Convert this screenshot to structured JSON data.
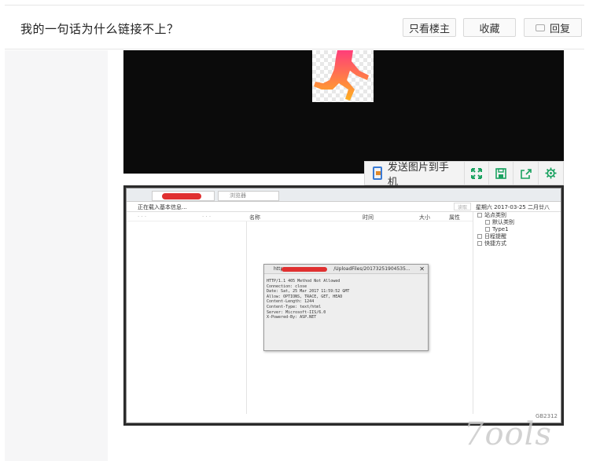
{
  "header": {
    "title": "我的一句话为什么链接不上？",
    "buttons": {
      "only_op": "只看楼主",
      "favorite": "收藏",
      "reply": "回复"
    }
  },
  "image_toolbar": {
    "send_to_phone": "发送图片到手机"
  },
  "screenshot": {
    "tab2": "浏览器",
    "loading": "正在载入基本信息...",
    "read_button": "读取",
    "date": "星期六 2017-03-25 二月廿八",
    "columns": {
      "name": "名称",
      "time": "时间",
      "size": "大小",
      "attr": "属性"
    },
    "dots1": "· · ·",
    "dots2": "· · ·",
    "tree": {
      "root": "站点类别",
      "children": [
        "默认类别",
        "Type1"
      ],
      "extra": [
        "日程提醒",
        "快捷方式"
      ]
    },
    "dialog": {
      "title_prefix": "http",
      "title_suffix": "/UploadFiles/20173251904535...",
      "lines": [
        "HTTP/1.1 405 Method Not Allowed",
        "Connection: close",
        "Date: Sat, 25 Mar 2017 11:59:52 GMT",
        "Allow: OPTIONS, TRACE, GET, HEAD",
        "Content-Length: 1244",
        "Content-Type: text/html",
        "Server: Microsoft-IIS/6.0",
        "X-Powered-By: ASP.NET"
      ]
    },
    "footer": "GB2312"
  },
  "watermark": "7ools",
  "colors": {
    "accent_green": "#1aa260",
    "redaction": "#e03030"
  },
  "icons": [
    "comment-bubble-icon",
    "phone-icon",
    "fullscreen-icon",
    "save-icon",
    "share-icon",
    "gear-icon"
  ]
}
